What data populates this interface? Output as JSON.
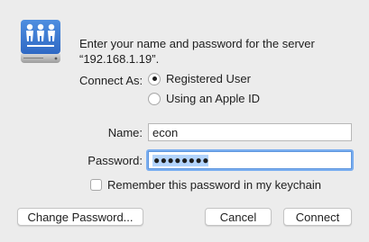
{
  "dialog": {
    "title_line1": "Enter your name and password for the server",
    "title_line2": "“192.168.1.19”.",
    "connect_as_label": "Connect As:",
    "options": [
      {
        "label": "Registered User",
        "selected": true
      },
      {
        "label": "Using an Apple ID",
        "selected": false
      }
    ],
    "name_label": "Name:",
    "name_value": "econ",
    "password_label": "Password:",
    "password_mask": "●●●●●●●●",
    "remember_label": "Remember this password in my keychain",
    "remember_checked": false,
    "buttons": {
      "change_password": "Change Password...",
      "cancel": "Cancel",
      "connect": "Connect"
    },
    "icon": "shared-server-icon",
    "focus_color": "#7aaef0"
  }
}
